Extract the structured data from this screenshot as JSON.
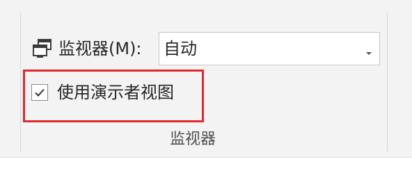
{
  "monitor": {
    "icon": "monitor-icon",
    "label": "监视器(M):",
    "selected_value": "自动"
  },
  "presenter_view": {
    "label": "使用演示者视图",
    "checked": true
  },
  "group": {
    "caption": "监视器"
  },
  "colors": {
    "highlight": "#e0292b",
    "ribbon_bg": "#f3f3f3"
  }
}
